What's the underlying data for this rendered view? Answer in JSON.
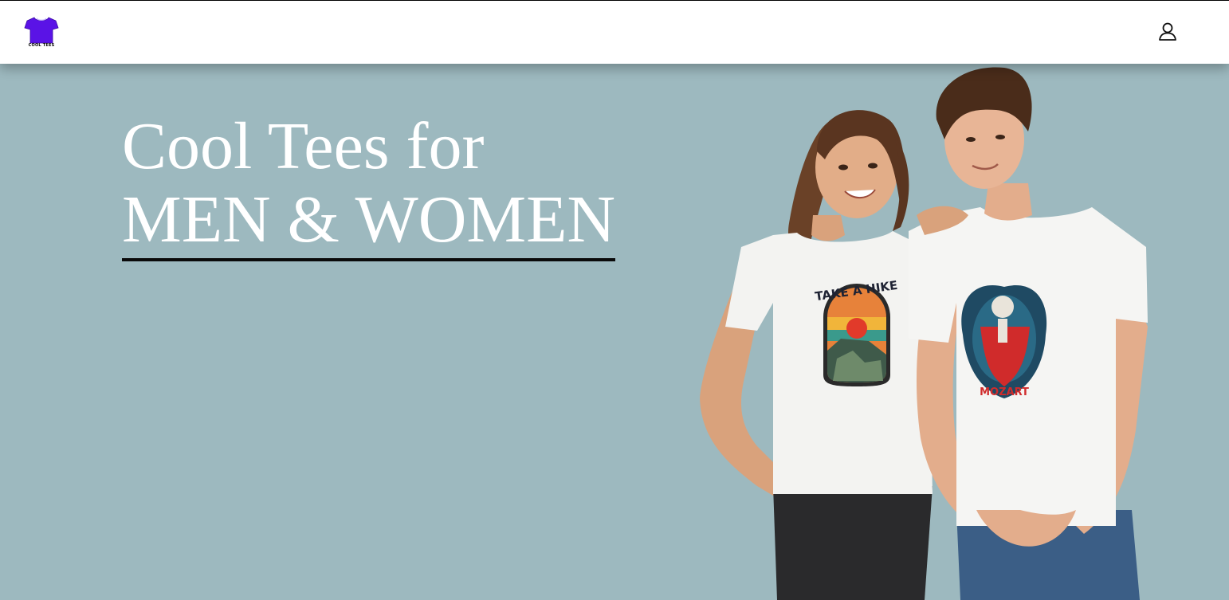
{
  "header": {
    "logo_text": "COOL TEES",
    "logo_icon": "tshirt-logo-icon",
    "account_icon": "user-account-icon"
  },
  "hero": {
    "title_line1": "Cool Tees for",
    "title_line2": "MEN & WOMEN"
  },
  "tshirt_prints": {
    "women_print_text": "TAKE A HIKE",
    "men_print_text": "MOZART"
  },
  "colors": {
    "background": "#9db9bf",
    "header_bg": "#ffffff",
    "logo_purple": "#5a13e6",
    "title_color": "#ffffff",
    "underline": "#0a0a0a"
  }
}
